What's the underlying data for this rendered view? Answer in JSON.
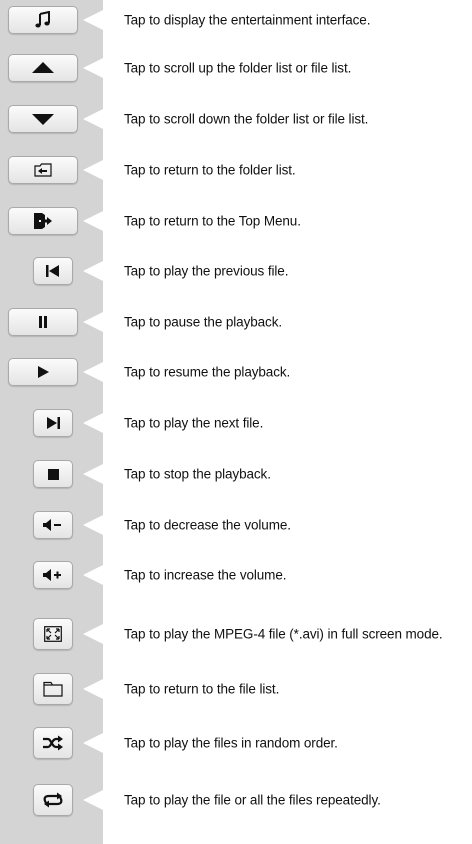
{
  "items": [
    {
      "icon": "music-note-icon",
      "text": "Tap to display the entertainment interface."
    },
    {
      "icon": "scroll-up-icon",
      "text": "Tap to scroll up the folder list or file list."
    },
    {
      "icon": "scroll-down-icon",
      "text": "Tap to scroll down the folder list or file list."
    },
    {
      "icon": "folder-return-icon",
      "text": "Tap to return to the folder list."
    },
    {
      "icon": "exit-door-icon",
      "text": "Tap to return to the Top Menu."
    },
    {
      "icon": "previous-track-icon",
      "text": "Tap to play the previous file."
    },
    {
      "icon": "pause-icon",
      "text": "Tap to pause the playback."
    },
    {
      "icon": "play-icon",
      "text": "Tap to resume the playback."
    },
    {
      "icon": "next-track-icon",
      "text": "Tap to play the next file."
    },
    {
      "icon": "stop-icon",
      "text": "Tap to stop the playback."
    },
    {
      "icon": "volume-down-icon",
      "text": "Tap to decrease the volume."
    },
    {
      "icon": "volume-up-icon",
      "text": "Tap to increase the volume."
    },
    {
      "icon": "fullscreen-icon",
      "text": "Tap to play the MPEG-4 file (*.avi) in full screen mode."
    },
    {
      "icon": "folder-icon",
      "text": "Tap to return to the file list."
    },
    {
      "icon": "shuffle-icon",
      "text": "Tap to play the files in random order."
    },
    {
      "icon": "repeat-icon",
      "text": "Tap to play the file or all the files repeatedly."
    }
  ]
}
